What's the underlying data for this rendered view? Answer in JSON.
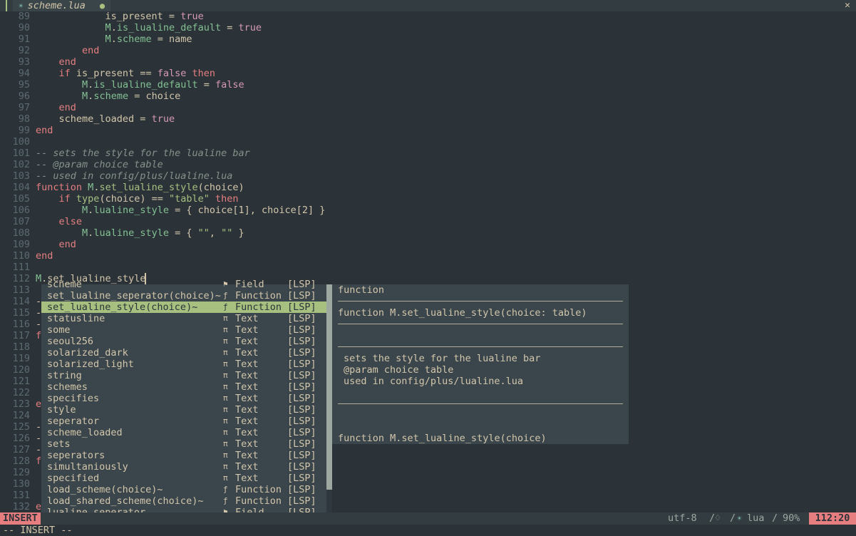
{
  "tabline": {
    "file_icon": "☀",
    "tab_name": "scheme.lua",
    "modified_mark": "●",
    "close": "✕"
  },
  "editor": {
    "lines": [
      {
        "n": "89",
        "segs": [
          [
            "sym",
            "            is_present = "
          ],
          [
            "bool",
            "true"
          ]
        ]
      },
      {
        "n": "90",
        "segs": [
          [
            "sym",
            "            "
          ],
          [
            "fld",
            "M"
          ],
          [
            "sym",
            "."
          ],
          [
            "fld",
            "is_lualine_default"
          ],
          [
            "sym",
            " = "
          ],
          [
            "bool",
            "true"
          ]
        ]
      },
      {
        "n": "91",
        "segs": [
          [
            "sym",
            "            "
          ],
          [
            "fld",
            "M"
          ],
          [
            "sym",
            "."
          ],
          [
            "fld",
            "scheme"
          ],
          [
            "sym",
            " = name"
          ]
        ]
      },
      {
        "n": "92",
        "segs": [
          [
            "kw",
            "        end"
          ]
        ]
      },
      {
        "n": "93",
        "segs": [
          [
            "kw",
            "    end"
          ]
        ]
      },
      {
        "n": "94",
        "segs": [
          [
            "kw",
            "    if"
          ],
          [
            "sym",
            " is_present == "
          ],
          [
            "bool",
            "false"
          ],
          [
            "kw",
            " then"
          ]
        ]
      },
      {
        "n": "95",
        "segs": [
          [
            "sym",
            "        "
          ],
          [
            "fld",
            "M"
          ],
          [
            "sym",
            "."
          ],
          [
            "fld",
            "is_lualine_default"
          ],
          [
            "sym",
            " = "
          ],
          [
            "bool",
            "false"
          ]
        ]
      },
      {
        "n": "96",
        "segs": [
          [
            "sym",
            "        "
          ],
          [
            "fld",
            "M"
          ],
          [
            "sym",
            "."
          ],
          [
            "fld",
            "scheme"
          ],
          [
            "sym",
            " = choice"
          ]
        ]
      },
      {
        "n": "97",
        "segs": [
          [
            "kw",
            "    end"
          ]
        ]
      },
      {
        "n": "98",
        "segs": [
          [
            "sym",
            "    scheme_loaded = "
          ],
          [
            "bool",
            "true"
          ]
        ]
      },
      {
        "n": "99",
        "segs": [
          [
            "kw",
            "end"
          ]
        ]
      },
      {
        "n": "100",
        "segs": []
      },
      {
        "n": "101",
        "segs": [
          [
            "cmt",
            "-- sets the style for the lualine bar"
          ]
        ]
      },
      {
        "n": "102",
        "segs": [
          [
            "cmt",
            "-- @param choice table"
          ]
        ]
      },
      {
        "n": "103",
        "segs": [
          [
            "cmt",
            "-- used in config/plus/lualine.lua"
          ]
        ]
      },
      {
        "n": "104",
        "segs": [
          [
            "kw",
            "function"
          ],
          [
            "sym",
            " "
          ],
          [
            "fld",
            "M"
          ],
          [
            "sym",
            "."
          ],
          [
            "fn",
            "set_lualine_style"
          ],
          [
            "sym",
            "(choice)"
          ]
        ]
      },
      {
        "n": "105",
        "segs": [
          [
            "kw",
            "    if"
          ],
          [
            "sym",
            " "
          ],
          [
            "fn",
            "type"
          ],
          [
            "sym",
            "(choice) == "
          ],
          [
            "str",
            "\"table\""
          ],
          [
            "kw",
            " then"
          ]
        ]
      },
      {
        "n": "106",
        "segs": [
          [
            "sym",
            "        "
          ],
          [
            "fld",
            "M"
          ],
          [
            "sym",
            "."
          ],
          [
            "fld",
            "lualine_style"
          ],
          [
            "sym",
            " = { choice[1], choice[2] }"
          ]
        ]
      },
      {
        "n": "107",
        "segs": [
          [
            "kw",
            "    else"
          ]
        ]
      },
      {
        "n": "108",
        "segs": [
          [
            "sym",
            "        "
          ],
          [
            "fld",
            "M"
          ],
          [
            "sym",
            "."
          ],
          [
            "fld",
            "lualine_style"
          ],
          [
            "sym",
            " = { "
          ],
          [
            "str",
            "\"\""
          ],
          [
            "sym",
            ", "
          ],
          [
            "str",
            "\"\""
          ],
          [
            "sym",
            " }"
          ]
        ]
      },
      {
        "n": "109",
        "segs": [
          [
            "kw",
            "    end"
          ]
        ]
      },
      {
        "n": "110",
        "segs": [
          [
            "kw",
            "end"
          ]
        ]
      },
      {
        "n": "111",
        "segs": []
      },
      {
        "n": "112",
        "segs": [
          [
            "fld",
            "M"
          ],
          [
            "sym",
            "."
          ],
          [
            "sym",
            "set_lualine_style"
          ]
        ]
      },
      {
        "n": "113",
        "segs": []
      },
      {
        "n": "114",
        "segs": [
          [
            "sym",
            "-"
          ]
        ]
      },
      {
        "n": "115",
        "segs": [
          [
            "sym",
            "-"
          ]
        ]
      },
      {
        "n": "116",
        "segs": [
          [
            "sym",
            "-"
          ]
        ]
      },
      {
        "n": "117",
        "segs": [
          [
            "kw",
            "f"
          ]
        ]
      },
      {
        "n": "118",
        "segs": []
      },
      {
        "n": "119",
        "segs": []
      },
      {
        "n": "120",
        "segs": []
      },
      {
        "n": "121",
        "segs": []
      },
      {
        "n": "122",
        "segs": []
      },
      {
        "n": "123",
        "segs": [
          [
            "kw",
            "e"
          ]
        ]
      },
      {
        "n": "124",
        "segs": []
      },
      {
        "n": "125",
        "segs": [
          [
            "sym",
            "-"
          ]
        ]
      },
      {
        "n": "126",
        "segs": [
          [
            "sym",
            "-"
          ]
        ]
      },
      {
        "n": "127",
        "segs": [
          [
            "sym",
            "-"
          ]
        ]
      },
      {
        "n": "128",
        "segs": [
          [
            "kw",
            "f"
          ]
        ]
      },
      {
        "n": "129",
        "segs": []
      },
      {
        "n": "130",
        "segs": []
      },
      {
        "n": "131",
        "segs": []
      },
      {
        "n": "132",
        "segs": [
          [
            "kw",
            "e"
          ]
        ]
      }
    ]
  },
  "completion": {
    "items": [
      {
        "word": "scheme",
        "icon": "⚑",
        "kind": "Field",
        "menu": "[LSP]"
      },
      {
        "word": "set_lualine_seperator(choice)~",
        "icon": "ƒ",
        "kind": "Function",
        "menu": "[LSP]"
      },
      {
        "word": "set_lualine_style(choice)~",
        "icon": "ƒ",
        "kind": "Function",
        "menu": "[LSP]",
        "selected": true
      },
      {
        "word": "statusline",
        "icon": "π",
        "kind": "Text",
        "menu": "[LSP]"
      },
      {
        "word": "some",
        "icon": "π",
        "kind": "Text",
        "menu": "[LSP]"
      },
      {
        "word": "seoul256",
        "icon": "π",
        "kind": "Text",
        "menu": "[LSP]"
      },
      {
        "word": "solarized_dark",
        "icon": "π",
        "kind": "Text",
        "menu": "[LSP]"
      },
      {
        "word": "solarized_light",
        "icon": "π",
        "kind": "Text",
        "menu": "[LSP]"
      },
      {
        "word": "string",
        "icon": "π",
        "kind": "Text",
        "menu": "[LSP]"
      },
      {
        "word": "schemes",
        "icon": "π",
        "kind": "Text",
        "menu": "[LSP]"
      },
      {
        "word": "specifies",
        "icon": "π",
        "kind": "Text",
        "menu": "[LSP]"
      },
      {
        "word": "style",
        "icon": "π",
        "kind": "Text",
        "menu": "[LSP]"
      },
      {
        "word": "seperator",
        "icon": "π",
        "kind": "Text",
        "menu": "[LSP]"
      },
      {
        "word": "scheme_loaded",
        "icon": "π",
        "kind": "Text",
        "menu": "[LSP]"
      },
      {
        "word": "sets",
        "icon": "π",
        "kind": "Text",
        "menu": "[LSP]"
      },
      {
        "word": "seperators",
        "icon": "π",
        "kind": "Text",
        "menu": "[LSP]"
      },
      {
        "word": "simultaniously",
        "icon": "π",
        "kind": "Text",
        "menu": "[LSP]"
      },
      {
        "word": "specified",
        "icon": "π",
        "kind": "Text",
        "menu": "[LSP]"
      },
      {
        "word": "load_scheme(choice)~",
        "icon": "ƒ",
        "kind": "Function",
        "menu": "[LSP]"
      },
      {
        "word": "load_shared_scheme(choice)~",
        "icon": "ƒ",
        "kind": "Function",
        "menu": "[LSP]"
      },
      {
        "word": "lualine_seperator",
        "icon": "⚑",
        "kind": "Field",
        "menu": "[LSP]"
      }
    ]
  },
  "docs": {
    "kind": "function",
    "signature": "function M.set_lualine_style(choice: table)",
    "desc": [
      "sets the style for the lualine bar",
      "@param choice table",
      "used in config/plus/lualine.lua"
    ],
    "footer": "function M.set_lualine_style(choice)"
  },
  "statusline": {
    "mode": "INSERT",
    "encoding": "utf-8",
    "sep": "/",
    "format": "♢",
    "ft_icon": "☀",
    "filetype": "lua",
    "percent": "90%",
    "position": "112:20"
  },
  "cmdline": "-- INSERT --"
}
